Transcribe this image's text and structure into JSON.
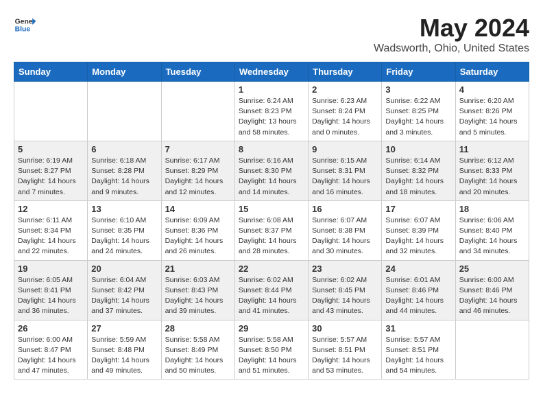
{
  "header": {
    "logo_general": "General",
    "logo_blue": "Blue",
    "month_title": "May 2024",
    "location": "Wadsworth, Ohio, United States"
  },
  "weekdays": [
    "Sunday",
    "Monday",
    "Tuesday",
    "Wednesday",
    "Thursday",
    "Friday",
    "Saturday"
  ],
  "weeks": [
    [
      {
        "day": "",
        "info": ""
      },
      {
        "day": "",
        "info": ""
      },
      {
        "day": "",
        "info": ""
      },
      {
        "day": "1",
        "info": "Sunrise: 6:24 AM\nSunset: 8:23 PM\nDaylight: 13 hours\nand 58 minutes."
      },
      {
        "day": "2",
        "info": "Sunrise: 6:23 AM\nSunset: 8:24 PM\nDaylight: 14 hours\nand 0 minutes."
      },
      {
        "day": "3",
        "info": "Sunrise: 6:22 AM\nSunset: 8:25 PM\nDaylight: 14 hours\nand 3 minutes."
      },
      {
        "day": "4",
        "info": "Sunrise: 6:20 AM\nSunset: 8:26 PM\nDaylight: 14 hours\nand 5 minutes."
      }
    ],
    [
      {
        "day": "5",
        "info": "Sunrise: 6:19 AM\nSunset: 8:27 PM\nDaylight: 14 hours\nand 7 minutes."
      },
      {
        "day": "6",
        "info": "Sunrise: 6:18 AM\nSunset: 8:28 PM\nDaylight: 14 hours\nand 9 minutes."
      },
      {
        "day": "7",
        "info": "Sunrise: 6:17 AM\nSunset: 8:29 PM\nDaylight: 14 hours\nand 12 minutes."
      },
      {
        "day": "8",
        "info": "Sunrise: 6:16 AM\nSunset: 8:30 PM\nDaylight: 14 hours\nand 14 minutes."
      },
      {
        "day": "9",
        "info": "Sunrise: 6:15 AM\nSunset: 8:31 PM\nDaylight: 14 hours\nand 16 minutes."
      },
      {
        "day": "10",
        "info": "Sunrise: 6:14 AM\nSunset: 8:32 PM\nDaylight: 14 hours\nand 18 minutes."
      },
      {
        "day": "11",
        "info": "Sunrise: 6:12 AM\nSunset: 8:33 PM\nDaylight: 14 hours\nand 20 minutes."
      }
    ],
    [
      {
        "day": "12",
        "info": "Sunrise: 6:11 AM\nSunset: 8:34 PM\nDaylight: 14 hours\nand 22 minutes."
      },
      {
        "day": "13",
        "info": "Sunrise: 6:10 AM\nSunset: 8:35 PM\nDaylight: 14 hours\nand 24 minutes."
      },
      {
        "day": "14",
        "info": "Sunrise: 6:09 AM\nSunset: 8:36 PM\nDaylight: 14 hours\nand 26 minutes."
      },
      {
        "day": "15",
        "info": "Sunrise: 6:08 AM\nSunset: 8:37 PM\nDaylight: 14 hours\nand 28 minutes."
      },
      {
        "day": "16",
        "info": "Sunrise: 6:07 AM\nSunset: 8:38 PM\nDaylight: 14 hours\nand 30 minutes."
      },
      {
        "day": "17",
        "info": "Sunrise: 6:07 AM\nSunset: 8:39 PM\nDaylight: 14 hours\nand 32 minutes."
      },
      {
        "day": "18",
        "info": "Sunrise: 6:06 AM\nSunset: 8:40 PM\nDaylight: 14 hours\nand 34 minutes."
      }
    ],
    [
      {
        "day": "19",
        "info": "Sunrise: 6:05 AM\nSunset: 8:41 PM\nDaylight: 14 hours\nand 36 minutes."
      },
      {
        "day": "20",
        "info": "Sunrise: 6:04 AM\nSunset: 8:42 PM\nDaylight: 14 hours\nand 37 minutes."
      },
      {
        "day": "21",
        "info": "Sunrise: 6:03 AM\nSunset: 8:43 PM\nDaylight: 14 hours\nand 39 minutes."
      },
      {
        "day": "22",
        "info": "Sunrise: 6:02 AM\nSunset: 8:44 PM\nDaylight: 14 hours\nand 41 minutes."
      },
      {
        "day": "23",
        "info": "Sunrise: 6:02 AM\nSunset: 8:45 PM\nDaylight: 14 hours\nand 43 minutes."
      },
      {
        "day": "24",
        "info": "Sunrise: 6:01 AM\nSunset: 8:46 PM\nDaylight: 14 hours\nand 44 minutes."
      },
      {
        "day": "25",
        "info": "Sunrise: 6:00 AM\nSunset: 8:46 PM\nDaylight: 14 hours\nand 46 minutes."
      }
    ],
    [
      {
        "day": "26",
        "info": "Sunrise: 6:00 AM\nSunset: 8:47 PM\nDaylight: 14 hours\nand 47 minutes."
      },
      {
        "day": "27",
        "info": "Sunrise: 5:59 AM\nSunset: 8:48 PM\nDaylight: 14 hours\nand 49 minutes."
      },
      {
        "day": "28",
        "info": "Sunrise: 5:58 AM\nSunset: 8:49 PM\nDaylight: 14 hours\nand 50 minutes."
      },
      {
        "day": "29",
        "info": "Sunrise: 5:58 AM\nSunset: 8:50 PM\nDaylight: 14 hours\nand 51 minutes."
      },
      {
        "day": "30",
        "info": "Sunrise: 5:57 AM\nSunset: 8:51 PM\nDaylight: 14 hours\nand 53 minutes."
      },
      {
        "day": "31",
        "info": "Sunrise: 5:57 AM\nSunset: 8:51 PM\nDaylight: 14 hours\nand 54 minutes."
      },
      {
        "day": "",
        "info": ""
      }
    ]
  ]
}
